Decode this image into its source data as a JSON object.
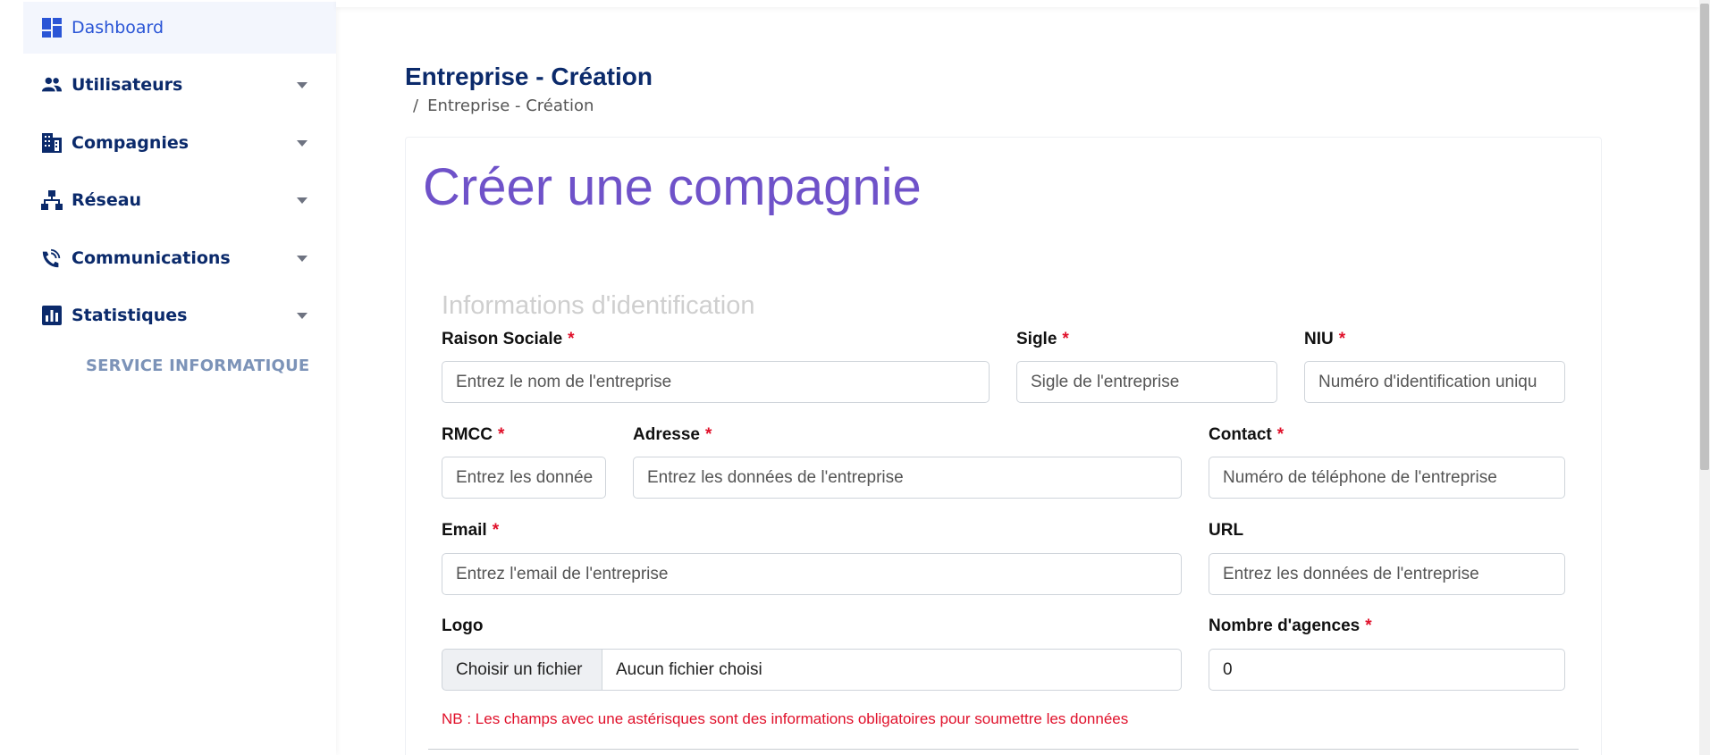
{
  "sidebar": {
    "items": [
      {
        "label": "Dashboard",
        "icon": "dashboard-icon"
      },
      {
        "label": "Utilisateurs",
        "icon": "users-icon"
      },
      {
        "label": "Compagnies",
        "icon": "building-icon"
      },
      {
        "label": "Réseau",
        "icon": "network-icon"
      },
      {
        "label": "Communications",
        "icon": "communications-icon"
      },
      {
        "label": "Statistiques",
        "icon": "statistics-icon"
      }
    ],
    "service": "SERVICE INFORMATIQUE"
  },
  "header": {
    "title": "Entreprise - Création",
    "breadcrumb_sep": "/",
    "breadcrumb": "Entreprise - Création"
  },
  "form": {
    "card_title": "Créer une compagnie",
    "section_title": "Informations d'identification",
    "required_mark": "*",
    "fields": {
      "raison_sociale": {
        "label": "Raison Sociale",
        "placeholder": "Entrez le nom de l'entreprise"
      },
      "sigle": {
        "label": "Sigle",
        "placeholder": "Sigle de l'entreprise"
      },
      "niu": {
        "label": "NIU",
        "placeholder": "Numéro d'identification uniqu"
      },
      "rmcc": {
        "label": "RMCC",
        "placeholder": "Entrez les donnée"
      },
      "adresse": {
        "label": "Adresse",
        "placeholder": "Entrez les données de l'entreprise"
      },
      "contact": {
        "label": "Contact",
        "placeholder": "Numéro de téléphone de l'entreprise"
      },
      "email": {
        "label": "Email",
        "placeholder": "Entrez l'email de l'entreprise"
      },
      "url": {
        "label": "URL",
        "placeholder": "Entrez les données de l'entreprise"
      },
      "logo": {
        "label": "Logo",
        "button": "Choisir un fichier",
        "file_name": "Aucun fichier choisi"
      },
      "nombre_agences": {
        "label": "Nombre d'agences",
        "value": "0"
      }
    },
    "note": "NB : Les champs avec une astérisques sont des informations obligatoires pour soumettre les données"
  },
  "colors": {
    "primary": "#0b2a6b",
    "active": "#2a55d6",
    "title_purple": "#6f52c9",
    "required": "#e0102a"
  }
}
